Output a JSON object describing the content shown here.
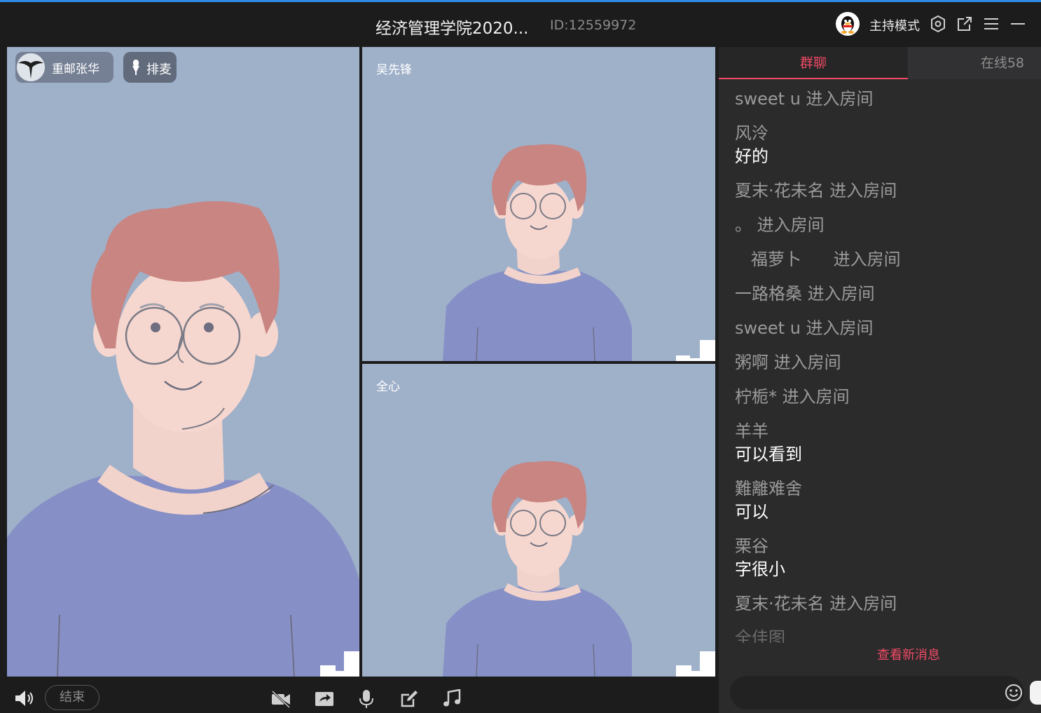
{
  "window": {
    "title": "经济管理学院2020...",
    "room_id": "ID:12559972",
    "host_mode": "主持模式"
  },
  "videos": {
    "main": {
      "name": "重邮张华",
      "queue_label": "排麦"
    },
    "top": {
      "name": "吴先锋"
    },
    "bottom": {
      "name": "全心"
    }
  },
  "chat": {
    "tab_group": "群聊",
    "tab_online": "在线58",
    "messages": [
      {
        "text": "sweet u 进入房间"
      },
      {
        "sender": "风泠",
        "text": "好的"
      },
      {
        "text": "夏末·花未名 进入房间"
      },
      {
        "text": "。 进入房间"
      },
      {
        "text": "   福萝卜      进入房间"
      },
      {
        "text": "一路格桑 进入房间"
      },
      {
        "text": "sweet u 进入房间"
      },
      {
        "text": "粥啊 进入房间"
      },
      {
        "text": "柠栀* 进入房间"
      },
      {
        "sender": "羊羊",
        "text": "可以看到"
      },
      {
        "sender": "難離难舍",
        "text": "可以"
      },
      {
        "sender": "栗谷",
        "text": "字很小"
      },
      {
        "text": "夏末·花未名 进入房间"
      },
      {
        "text": "全佳图"
      }
    ],
    "new_messages": "查看新消息"
  },
  "controls": {
    "end_label": "结束"
  },
  "colors": {
    "accent": "#ef4a64",
    "video_bg": "#9fb0c9",
    "panel": "#2b2b2c"
  }
}
